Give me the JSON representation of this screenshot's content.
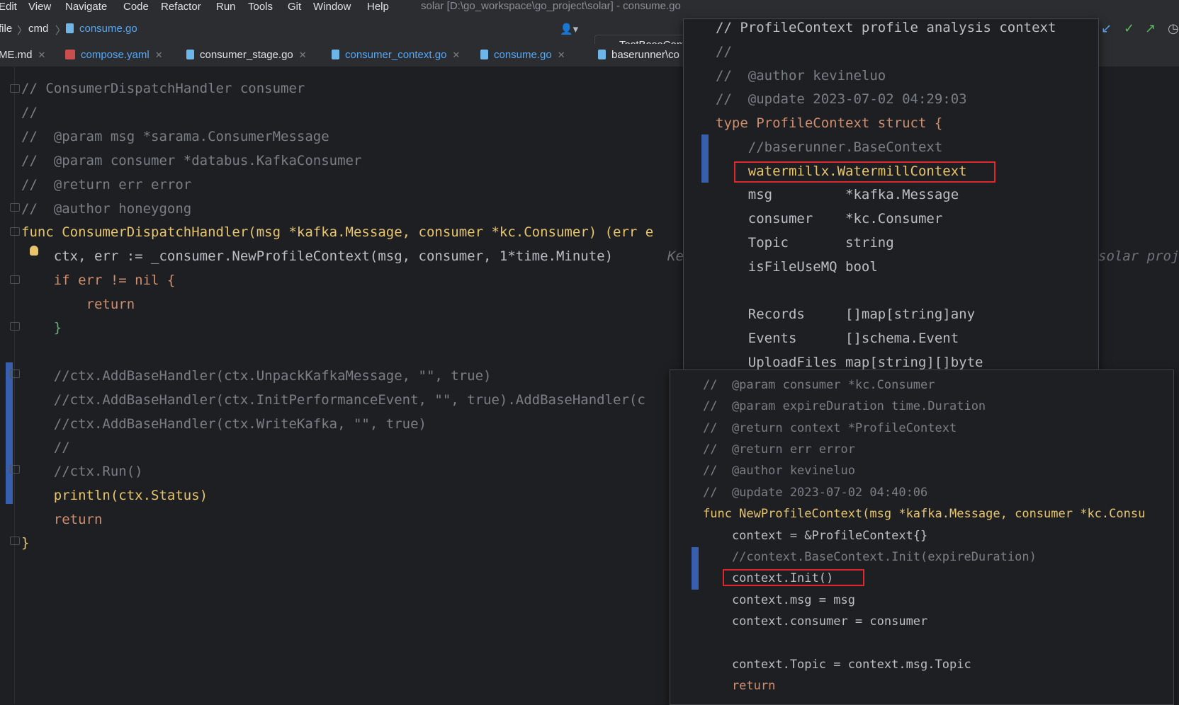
{
  "menu": {
    "items": [
      "Edit",
      "View",
      "Navigate",
      "Code",
      "Refactor",
      "Run",
      "Tools",
      "Git",
      "Window",
      "Help"
    ],
    "window_title": "solar [D:\\go_workspace\\go_project\\solar] - consume.go"
  },
  "navbar": {
    "crumbs": [
      "file",
      "cmd",
      "consume.go"
    ],
    "run_config": "TestBaseContext"
  },
  "tabs": [
    {
      "label": "ME.md",
      "type": "md"
    },
    {
      "label": "compose.yaml",
      "type": "yaml"
    },
    {
      "label": "consumer_stage.go",
      "type": "go"
    },
    {
      "label": "consumer_context.go",
      "type": "go"
    },
    {
      "label": "consume.go",
      "type": "go",
      "active": true
    },
    {
      "label": "baserunner\\co",
      "type": "go"
    }
  ],
  "editor": {
    "lines": [
      "// ConsumerDispatchHandler consumer",
      "//",
      "//  @param msg *sarama.ConsumerMessage",
      "//  @param consumer *databus.KafkaConsumer",
      "//  @return err error",
      "//  @author honeygong",
      "func ConsumerDispatchHandler(msg *kafka.Message, consumer *kc.Consumer) (err e",
      "    ctx, err := _consumer.NewProfileContext(msg, consumer, 1*time.Minute)",
      "    if err != nil {",
      "        return",
      "    }",
      "",
      "    //ctx.AddBaseHandler(ctx.UnpackKafkaMessage, \"\", true)",
      "    //ctx.AddBaseHandler(ctx.InitPerformanceEvent, \"\", true).AddBaseHandler(c",
      "    //ctx.AddBaseHandler(ctx.WriteKafka, \"\", true)",
      "    //",
      "    //ctx.Run()",
      "    println(ctx.Status)",
      "    return",
      "}"
    ],
    "inlay_hint": "Ke",
    "inlay_hint_right": "solar proj"
  },
  "popup_struct": {
    "lines": [
      "// ProfileContext profile analysis context",
      "//",
      "//  @author kevineluo",
      "//  @update 2023-07-02 04:29:03",
      "type ProfileContext struct {",
      "    //baserunner.BaseContext",
      "    watermillx.WatermillContext",
      "    msg         *kafka.Message",
      "    consumer    *kc.Consumer",
      "    Topic       string",
      "    isFileUseMQ bool",
      "",
      "    Records     []map[string]any",
      "    Events      []schema.Event",
      "    UploadFiles map[string][]byte"
    ]
  },
  "popup_func": {
    "lines": [
      "//  @param consumer *kc.Consumer",
      "//  @param expireDuration time.Duration",
      "//  @return context *ProfileContext",
      "//  @return err error",
      "//  @author kevineluo",
      "//  @update 2023-07-02 04:40:06",
      "func NewProfileContext(msg *kafka.Message, consumer *kc.Consu",
      "    context = &ProfileContext{}",
      "    //context.BaseContext.Init(expireDuration)",
      "    context.Init()",
      "    context.msg = msg",
      "    context.consumer = consumer",
      "",
      "    context.Topic = context.msg.Topic",
      "    return"
    ]
  },
  "colors": {
    "background": "#1e1f22",
    "comment": "#7a7e85",
    "keyword": "#cf8e6d",
    "function": "#e8c56c",
    "type": "#56a8f5",
    "highlight_box": "#e0282c",
    "active_tab_underline": "#b05ce6"
  }
}
